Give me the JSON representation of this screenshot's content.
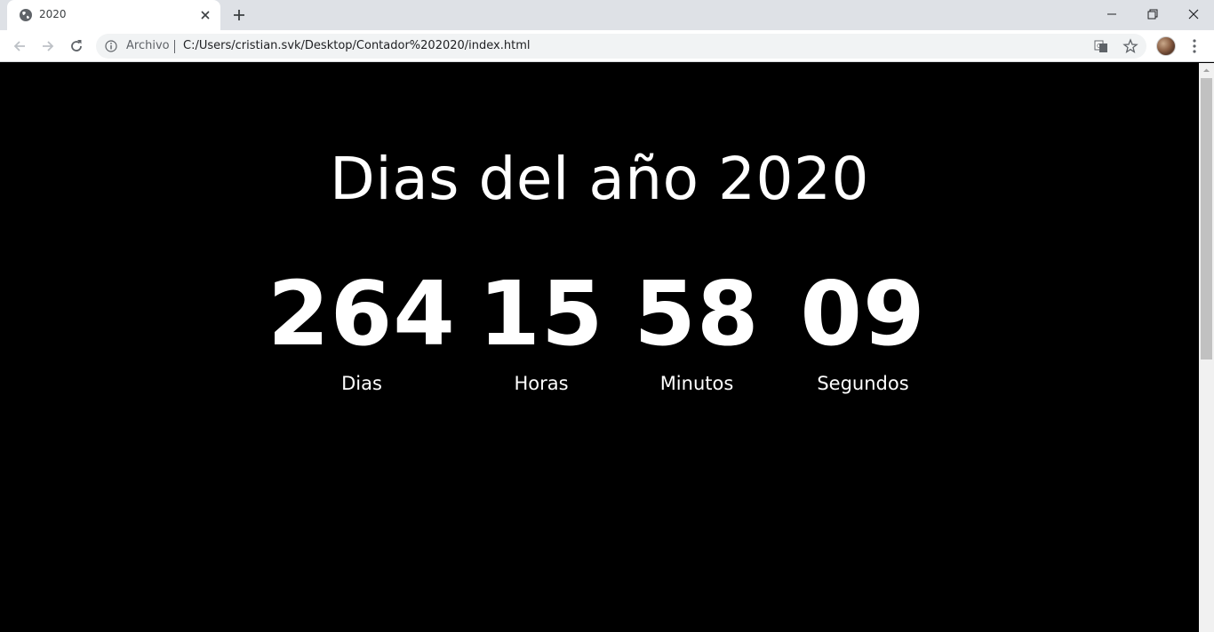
{
  "browser": {
    "tab": {
      "title": "2020",
      "favicon": "globe-icon"
    },
    "omnibox": {
      "scheme_label": "Archivo",
      "url": "C:/Users/cristian.svk/Desktop/Contador%202020/index.html"
    }
  },
  "page": {
    "title": "Dias del año 2020",
    "countdown": [
      {
        "value": "264",
        "label": "Dias"
      },
      {
        "value": "15",
        "label": "Horas"
      },
      {
        "value": "58",
        "label": "Minutos"
      },
      {
        "value": "09",
        "label": "Segundos"
      }
    ]
  },
  "colors": {
    "page_background": "#000000",
    "text": "#ffffff",
    "tabstrip": "#dee1e6",
    "omnibox": "#f1f3f4"
  }
}
